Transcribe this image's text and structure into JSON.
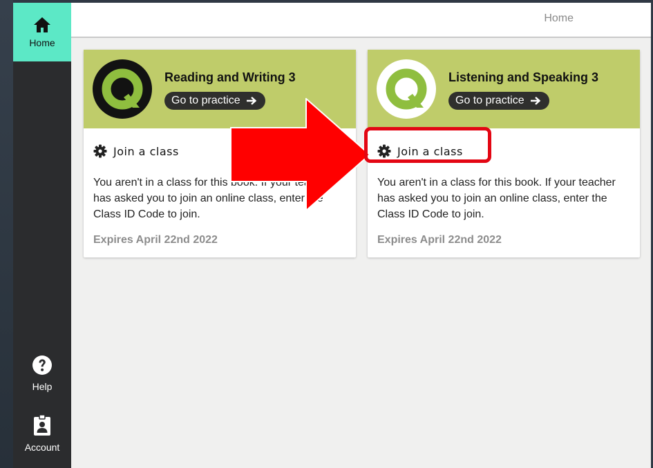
{
  "sidebar": {
    "items": [
      {
        "label": "Home",
        "icon": "home-icon",
        "active": true
      },
      {
        "label": "Help",
        "icon": "question-icon"
      },
      {
        "label": "Account",
        "icon": "badge-icon"
      }
    ]
  },
  "header": {
    "title": "Home"
  },
  "books": [
    {
      "title": "Reading and Writing 3",
      "practice_label": "Go to practice",
      "join_label": "Join a class",
      "description": "You aren't in a class for this book. If your teacher has asked you to join an online class, enter the Class ID Code to join.",
      "expires": "Expires April 22nd 2022",
      "logo_style": "dark"
    },
    {
      "title": "Listening and Speaking 3",
      "practice_label": "Go to practice",
      "join_label": "Join a class",
      "description": "You aren't in a class for this book. If your teacher has asked you to join an online class, enter the Class ID Code to join.",
      "expires": "Expires April 22nd 2022",
      "logo_style": "light"
    }
  ],
  "colors": {
    "accent": "#5ce8c6",
    "card_header": "#bfcc6a",
    "sidebar": "#2b2c2e",
    "annotation": "#e30613"
  }
}
